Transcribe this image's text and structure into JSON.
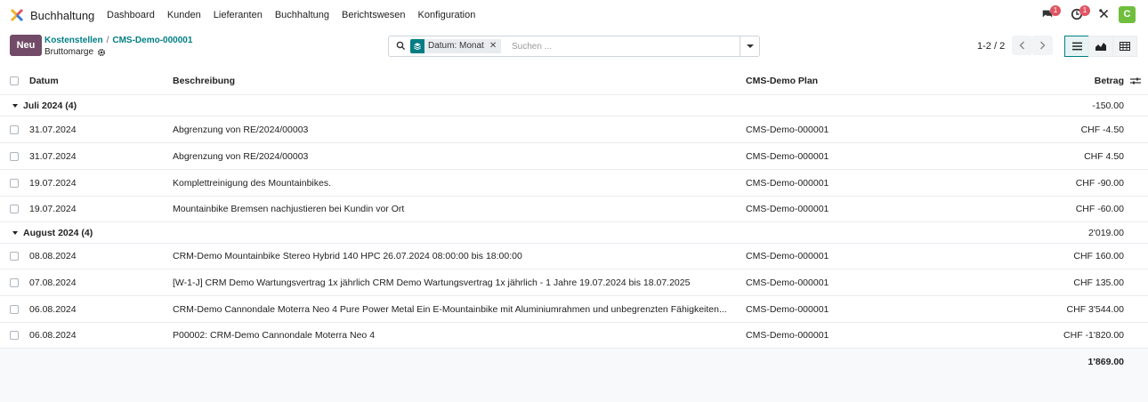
{
  "navbar": {
    "app_name": "Buchhaltung",
    "menu": [
      "Dashboard",
      "Kunden",
      "Lieferanten",
      "Buchhaltung",
      "Berichtswesen",
      "Konfiguration"
    ],
    "chat_badge": "1",
    "activity_badge": "1",
    "avatar_letter": "C"
  },
  "control": {
    "new_button": "Neu",
    "breadcrumb_parent": "Kostenstellen",
    "breadcrumb_current": "CMS-Demo-000001",
    "subtitle": "Bruttomarge",
    "facet_label": "Datum: Monat",
    "facet_close": "✕",
    "search_placeholder": "Suchen ...",
    "pager": "1-2 / 2"
  },
  "table": {
    "headers": {
      "date": "Datum",
      "description": "Beschreibung",
      "plan": "CMS-Demo Plan",
      "amount": "Betrag"
    },
    "groups": [
      {
        "label": "Juli 2024 (4)",
        "total": "-150.00",
        "rows": [
          {
            "date": "31.07.2024",
            "description": "Abgrenzung von RE/2024/00003",
            "plan": "CMS-Demo-000001",
            "amount": "CHF -4.50"
          },
          {
            "date": "31.07.2024",
            "description": "Abgrenzung von RE/2024/00003",
            "plan": "CMS-Demo-000001",
            "amount": "CHF 4.50"
          },
          {
            "date": "19.07.2024",
            "description": "Komplettreinigung des Mountainbikes.",
            "plan": "CMS-Demo-000001",
            "amount": "CHF -90.00"
          },
          {
            "date": "19.07.2024",
            "description": "Mountainbike Bremsen nachjustieren bei Kundin vor Ort",
            "plan": "CMS-Demo-000001",
            "amount": "CHF -60.00"
          }
        ]
      },
      {
        "label": "August 2024 (4)",
        "total": "2'019.00",
        "rows": [
          {
            "date": "08.08.2024",
            "description": "CRM-Demo Mountainbike Stereo Hybrid 140 HPC 26.07.2024 08:00:00 bis 18:00:00",
            "plan": "CMS-Demo-000001",
            "amount": "CHF 160.00"
          },
          {
            "date": "07.08.2024",
            "description": "[W-1-J] CRM Demo Wartungsvertrag 1x jährlich CRM Demo Wartungsvertrag 1x jährlich - 1 Jahre 19.07.2024 bis 18.07.2025",
            "plan": "CMS-Demo-000001",
            "amount": "CHF 135.00"
          },
          {
            "date": "06.08.2024",
            "description": "CRM-Demo Cannondale Moterra Neo 4 Pure Power Metal Ein E-Mountainbike mit Aluminiumrahmen und unbegrenzten Fähigkeiten...",
            "plan": "CMS-Demo-000001",
            "amount": "CHF 3'544.00"
          },
          {
            "date": "06.08.2024",
            "description": "P00002: CRM-Demo Cannondale Moterra Neo 4",
            "plan": "CMS-Demo-000001",
            "amount": "CHF -1'820.00"
          }
        ]
      }
    ],
    "grand_total": "1'869.00"
  },
  "colors": {
    "brand": "#714b67",
    "accent": "#017e84",
    "badge": "#e05563",
    "avatar": "#6fbf3d"
  }
}
